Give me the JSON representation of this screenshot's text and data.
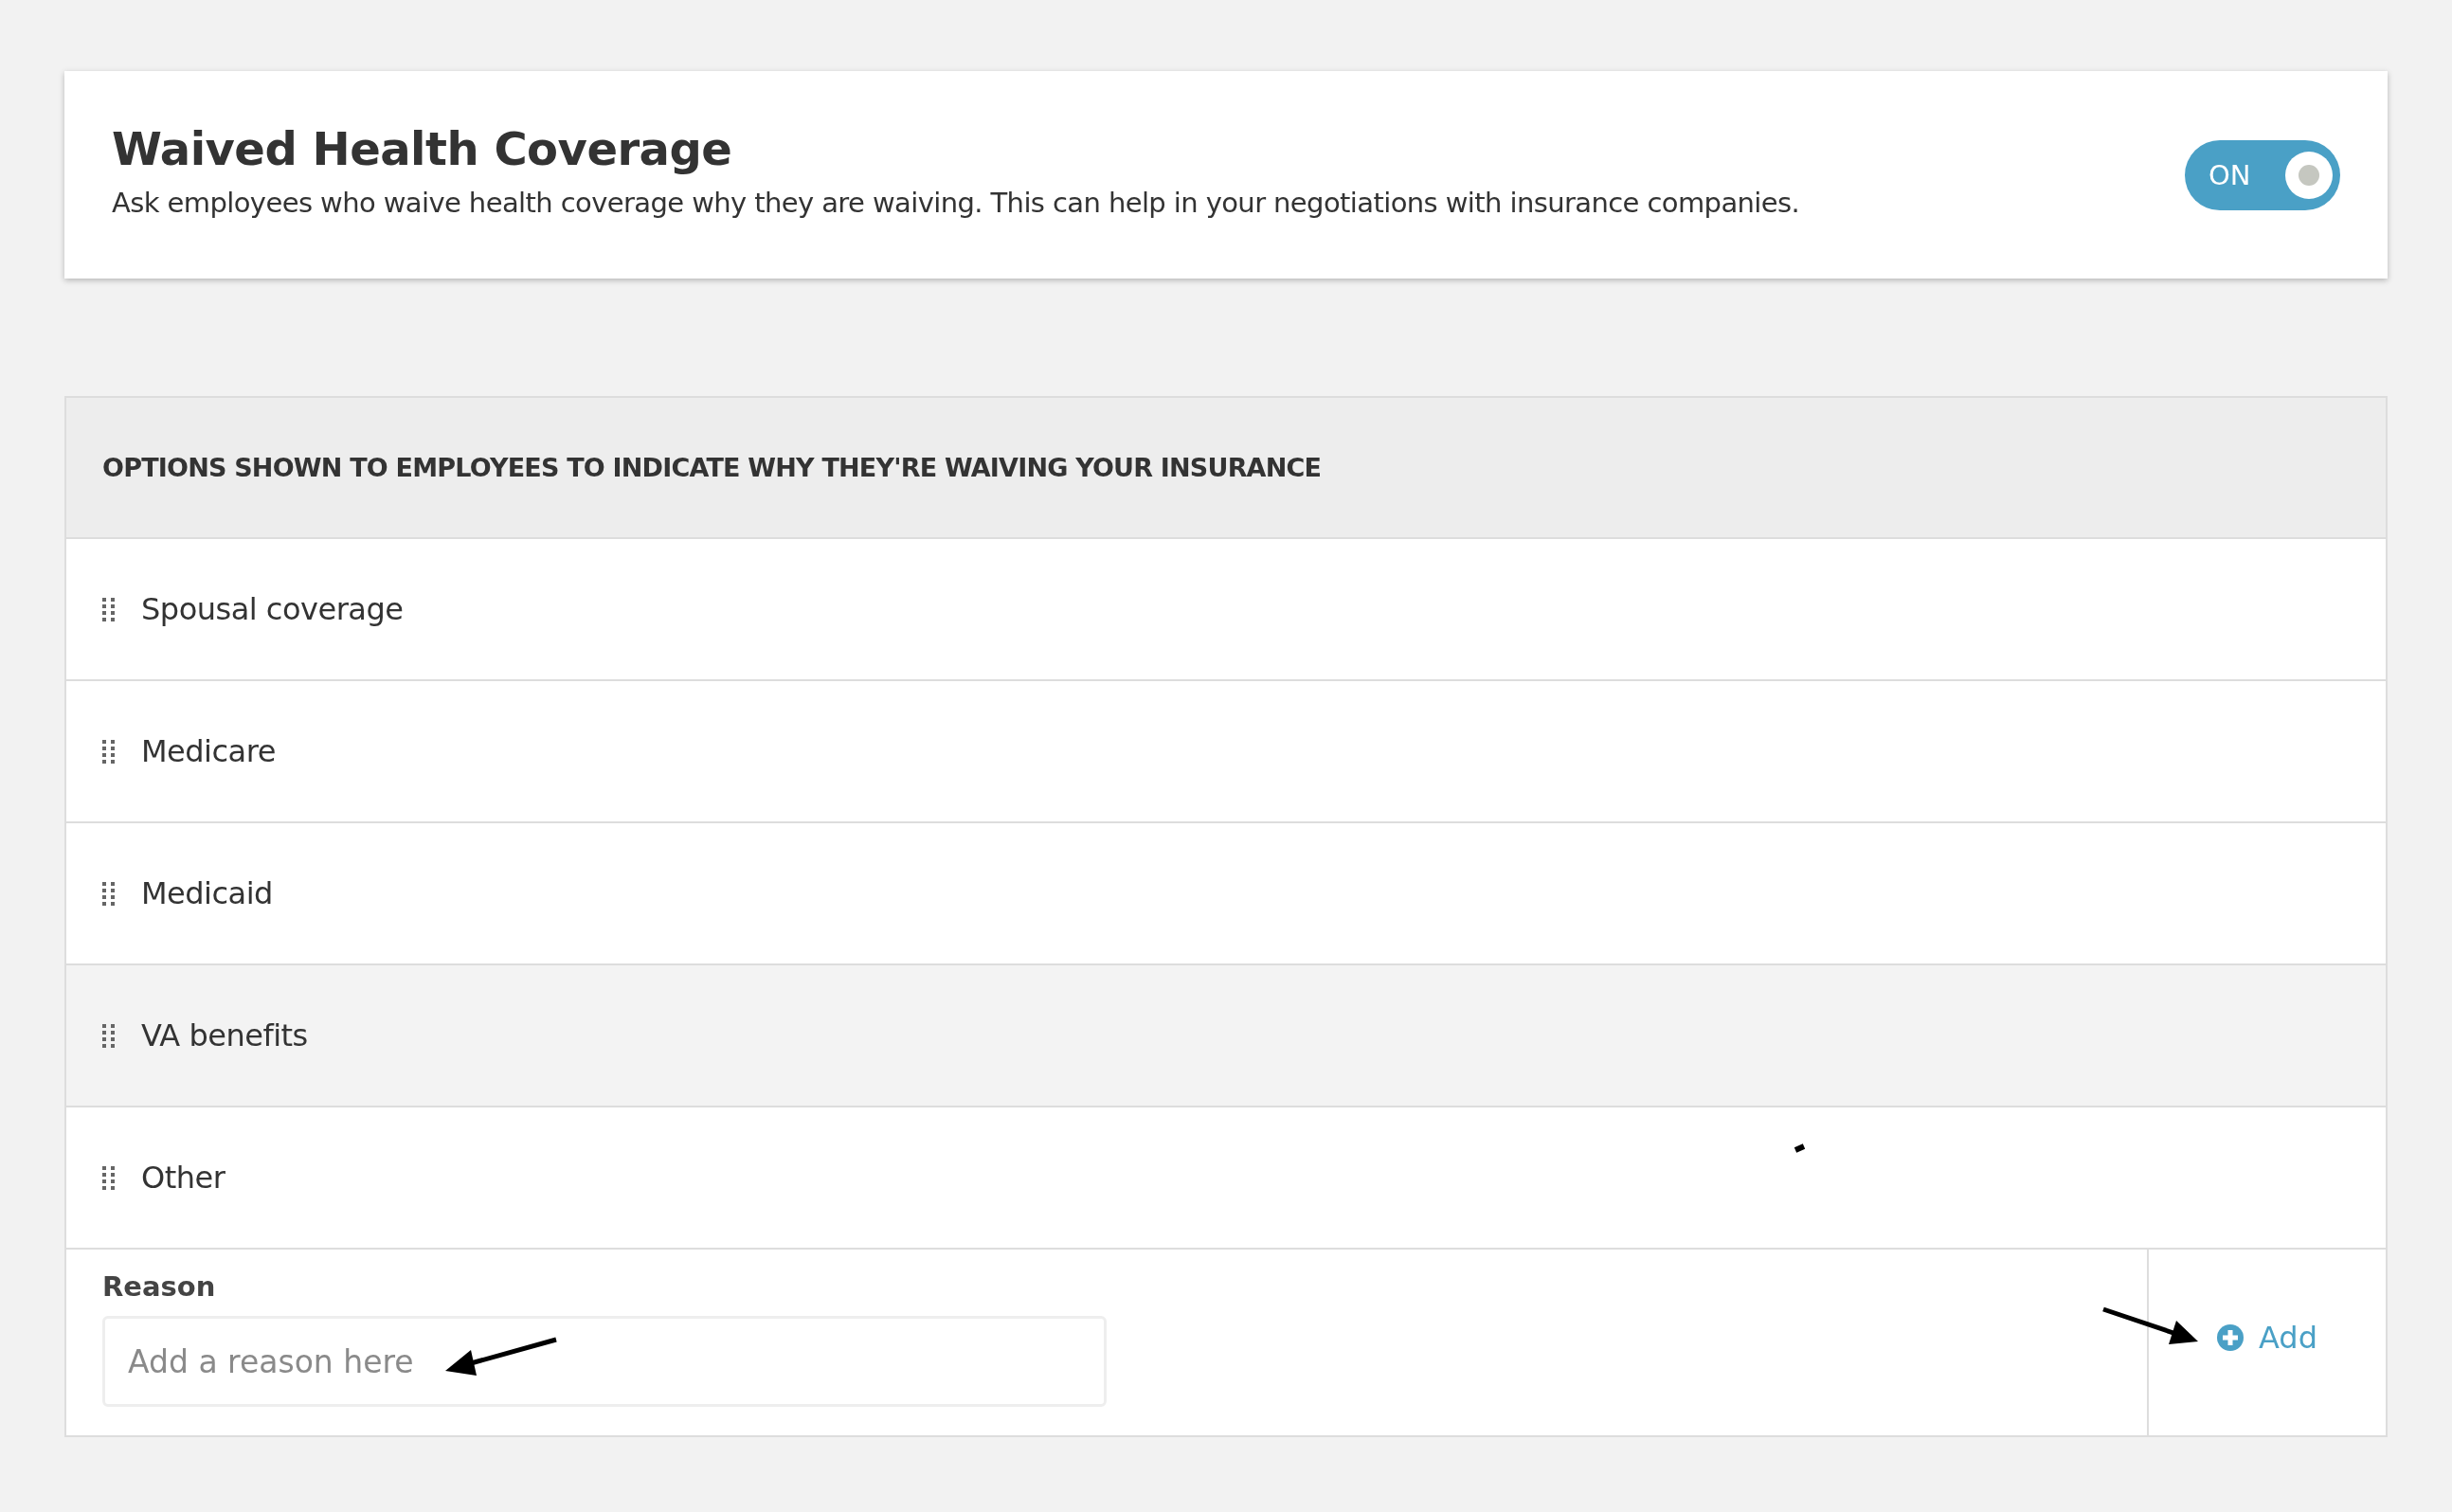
{
  "settings_card": {
    "title": "Waived Health Coverage",
    "description": "Ask employees who waive health coverage why they are waiving. This can help in your negotiations with insurance companies.",
    "toggle": {
      "label": "ON",
      "on": true
    }
  },
  "options_panel": {
    "heading": "OPTIONS SHOWN TO EMPLOYEES TO INDICATE WHY THEY'RE WAIVING YOUR INSURANCE",
    "options": [
      {
        "label": "Spousal coverage",
        "highlighted": false
      },
      {
        "label": "Medicare",
        "highlighted": false
      },
      {
        "label": "Medicaid",
        "highlighted": false
      },
      {
        "label": "VA benefits",
        "highlighted": true
      },
      {
        "label": "Other",
        "highlighted": false
      }
    ],
    "reason_field": {
      "label": "Reason",
      "placeholder": "Add a reason here"
    },
    "add_button": {
      "label": "Add"
    }
  }
}
